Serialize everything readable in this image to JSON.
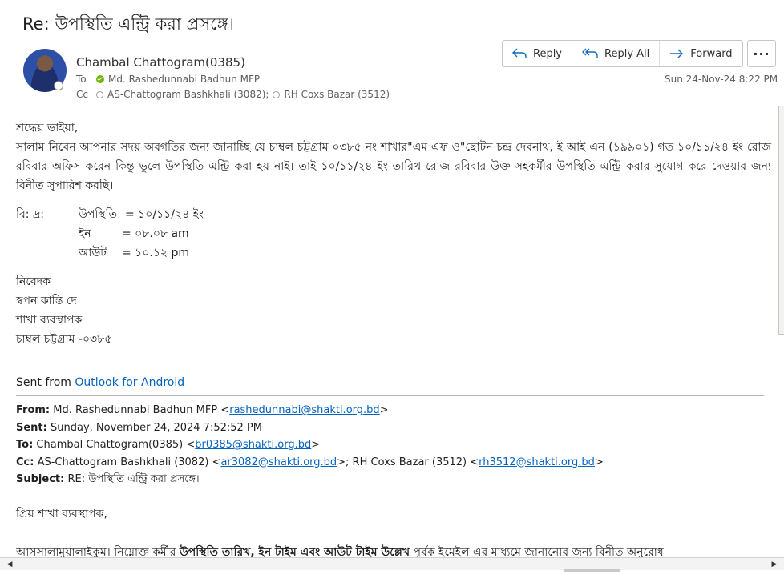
{
  "email": {
    "subject": "Re: উপস্থিতি এন্ট্রি করা প্রসঙ্গে।",
    "sender": "Chambal Chattogram(0385)",
    "to_label": "To",
    "to": "Md. Rashedunnabi Badhun MFP",
    "cc_label": "Cc",
    "cc": [
      "AS-Chattogram Bashkhali (3082);",
      "RH Coxs Bazar (3512)"
    ],
    "date": "Sun 24-Nov-24 8:22 PM"
  },
  "actions": {
    "reply": "Reply",
    "reply_all": "Reply All",
    "forward": "Forward",
    "more": "···"
  },
  "body": {
    "salutation": "শ্রদ্ধেয় ভাইয়া,",
    "paragraph": "সালাম নিবেন আপনার সদয় অবগতির জন্য জানাচ্ছি যে চাম্বল চট্টগ্রাম ০৩৮৫ নং শাখার\"এম এফ ও\"ছোটন চন্দ্র দেবনাথ, ই আই এন (১৯৯০১) গত ১০/১১/২৪ ইং রোজ রবিবার অফিস করেন কিন্তু ভুলে উপস্থিতি এন্ট্রি করা হয় নাই। তাই ১০/১১/২৪ ইং তারিখ রোজ রবিবার উক্ত সহকর্মীর উপস্থিতি এন্ট্রি করার সুযোগ করে দেওয়ার জন্য বিনীত সুপারিশ করছি।",
    "bd_label": "বি: দ্র:",
    "attendance_label": "উপস্থিতি",
    "attendance_value": "= ১০/১১/২৪ ইং",
    "in_label": "ইন",
    "in_value": "= ০৮.০৮ am",
    "out_label": "আউট",
    "out_value": "= ১০.১২ pm",
    "sign": [
      "নিবেদক",
      "স্বপন কান্তি দে",
      "শাখা ব্যবস্থাপক",
      "চাম্বল চট্টগ্রাম -০৩৮৫"
    ],
    "sent_from_prefix": "Sent from ",
    "sent_from_link": "Outlook for Android"
  },
  "quoted": {
    "from_label": "From:",
    "from_name": " Md. Rashedunnabi Badhun MFP <",
    "from_email": "rashedunnabi@shakti.org.bd",
    "from_close": ">",
    "sent_label": "Sent:",
    "sent_value": " Sunday, November 24, 2024 7:52:52 PM",
    "to_label": "To:",
    "to_name": " Chambal Chattogram(0385) <",
    "to_email": "br0385@shakti.org.bd",
    "to_close": ">",
    "cc_label": "Cc:",
    "cc_name1": " AS-Chattogram Bashkhali (3082) <",
    "cc_email1": "ar3082@shakti.org.bd",
    "cc_mid": ">; RH Coxs Bazar (3512) <",
    "cc_email2": "rh3512@shakti.org.bd",
    "cc_close": ">",
    "subject_label": "Subject:",
    "subject_value": " RE: উপস্থিতি এন্ট্রি করা প্রসঙ্গে।",
    "greeting": "প্রিয় শাখা ব্যবস্থাপক,",
    "last_start": "আসসালামুয়ালাইকুম। নিম্নোক্ত কর্মীর ",
    "last_bold": "উপস্থিতি তারিখ, ইন টাইম এবং আউট টাইম উল্লেখ",
    "last_end": " পূর্বক ইমেইল এর মাধ্যমে জানানোর জন্য বিনীত অনুরোধ"
  }
}
